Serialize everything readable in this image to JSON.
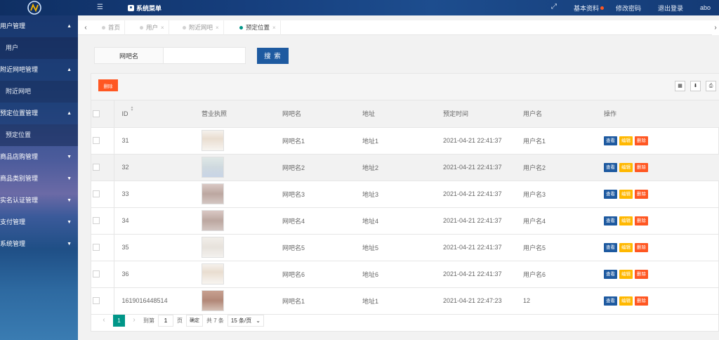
{
  "header": {
    "system_menu": "系统菜单",
    "links": [
      "基本资料",
      "修改密码",
      "退出登录"
    ],
    "user": "abo"
  },
  "sidebar": {
    "items": [
      {
        "label": "用户管理",
        "type": "group",
        "state": "open"
      },
      {
        "label": "用户",
        "type": "sub"
      },
      {
        "label": "附近网吧管理",
        "type": "group",
        "state": "open"
      },
      {
        "label": "附近网吧",
        "type": "sub"
      },
      {
        "label": "预定位置管理",
        "type": "group",
        "state": "open"
      },
      {
        "label": "预定位置",
        "type": "sub"
      },
      {
        "label": "商品店购管理",
        "type": "group",
        "state": "closed"
      },
      {
        "label": "商品类别管理",
        "type": "group",
        "state": "closed"
      },
      {
        "label": "实名认证管理",
        "type": "group",
        "state": "closed"
      },
      {
        "label": "支付管理",
        "type": "group",
        "state": "closed"
      },
      {
        "label": "系统管理",
        "type": "group",
        "state": "closed"
      }
    ]
  },
  "tabs": [
    {
      "label": "首页",
      "closable": false,
      "active": false
    },
    {
      "label": "用户",
      "closable": true,
      "active": false
    },
    {
      "label": "附近网吧",
      "closable": true,
      "active": false
    },
    {
      "label": "预定位置",
      "closable": true,
      "active": true
    }
  ],
  "search": {
    "label": "网吧名",
    "value": "",
    "button": "搜 索"
  },
  "toolbar": {
    "delete_label": "删除"
  },
  "table": {
    "columns": [
      "ID",
      "营业执照",
      "网吧名",
      "地址",
      "预定时间",
      "用户名",
      "操作"
    ],
    "rows": [
      {
        "id": "31",
        "name": "网吧名1",
        "address": "地址1",
        "time": "2021-04-21 22:41:37",
        "user": "用户名1"
      },
      {
        "id": "32",
        "name": "网吧名2",
        "address": "地址2",
        "time": "2021-04-21 22:41:37",
        "user": "用户名2"
      },
      {
        "id": "33",
        "name": "网吧名3",
        "address": "地址3",
        "time": "2021-04-21 22:41:37",
        "user": "用户名3"
      },
      {
        "id": "34",
        "name": "网吧名4",
        "address": "地址4",
        "time": "2021-04-21 22:41:37",
        "user": "用户名4"
      },
      {
        "id": "35",
        "name": "网吧名5",
        "address": "地址5",
        "time": "2021-04-21 22:41:37",
        "user": "用户名5"
      },
      {
        "id": "36",
        "name": "网吧名6",
        "address": "地址6",
        "time": "2021-04-21 22:41:37",
        "user": "用户名6"
      },
      {
        "id": "1619016448514",
        "name": "网吧名1",
        "address": "地址1",
        "time": "2021-04-21 22:47:23",
        "user": "12"
      }
    ],
    "actions": {
      "view": "查看",
      "edit": "编辑",
      "delete": "删除"
    }
  },
  "pager": {
    "current_page": "1",
    "goto_label": "到第",
    "goto_value": "1",
    "page_unit": "页",
    "confirm": "确定",
    "total": "共 7 条",
    "page_size": "15 条/页"
  },
  "colors": {
    "primary": "#1e5aa0",
    "danger": "#ff5722",
    "warning": "#ffb800",
    "teal": "#009688"
  }
}
